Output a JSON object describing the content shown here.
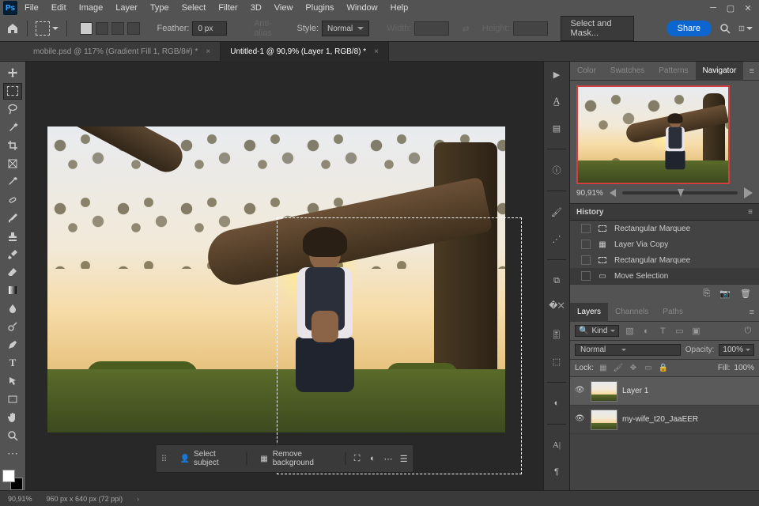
{
  "menubar": {
    "items": [
      "File",
      "Edit",
      "Image",
      "Layer",
      "Type",
      "Select",
      "Filter",
      "3D",
      "View",
      "Plugins",
      "Window",
      "Help"
    ]
  },
  "optbar": {
    "feather_label": "Feather:",
    "feather_value": "0 px",
    "antialias": "Anti-alias",
    "style_label": "Style:",
    "style_value": "Normal",
    "width_label": "Width:",
    "height_label": "Height:",
    "select_mask": "Select and Mask...",
    "share": "Share"
  },
  "tabs": [
    {
      "label": "mobile.psd @ 117% (Gradient Fill 1, RGB/8#) *",
      "active": false
    },
    {
      "label": "Untitled-1 @ 90,9% (Layer 1, RGB/8) *",
      "active": true
    }
  ],
  "tools": [
    "move",
    "marquee",
    "lasso",
    "wand",
    "crop",
    "frame",
    "eyedrop",
    "heal",
    "brush",
    "stamp",
    "history-brush",
    "eraser",
    "gradient",
    "blur",
    "dodge",
    "pen",
    "type",
    "path-sel",
    "rect",
    "hand",
    "zoom"
  ],
  "ctxbar": {
    "select_subject": "Select subject",
    "remove_bg": "Remove background"
  },
  "rstrip_icons": [
    "play",
    "a",
    "learn",
    "history",
    "clock",
    "brush-panel",
    "gradient-panel",
    "adjust",
    "swatches-panel",
    "style",
    "cube",
    "ball",
    "char",
    "align",
    "a2",
    "para"
  ],
  "panel_tabs_top": [
    "Color",
    "Swatches",
    "Patterns",
    "Navigator"
  ],
  "nav_zoom": "90,91%",
  "history": {
    "title": "History",
    "items": [
      {
        "icon": "marquee",
        "label": "Rectangular Marquee"
      },
      {
        "icon": "layer",
        "label": "Layer Via Copy"
      },
      {
        "icon": "marquee",
        "label": "Rectangular Marquee"
      },
      {
        "icon": "move",
        "label": "Move Selection"
      }
    ],
    "selected": 3
  },
  "layers": {
    "tabs": [
      "Layers",
      "Channels",
      "Paths"
    ],
    "kind": "Kind",
    "blend": "Normal",
    "opacity_label": "Opacity:",
    "opacity": "100%",
    "lock_label": "Lock:",
    "fill_label": "Fill:",
    "fill": "100%",
    "items": [
      {
        "name": "Layer 1",
        "selected": true
      },
      {
        "name": "my-wife_t20_JaaEER",
        "selected": false
      }
    ]
  },
  "status": {
    "zoom": "90,91%",
    "doc": "960 px x 640 px (72 ppi)"
  }
}
